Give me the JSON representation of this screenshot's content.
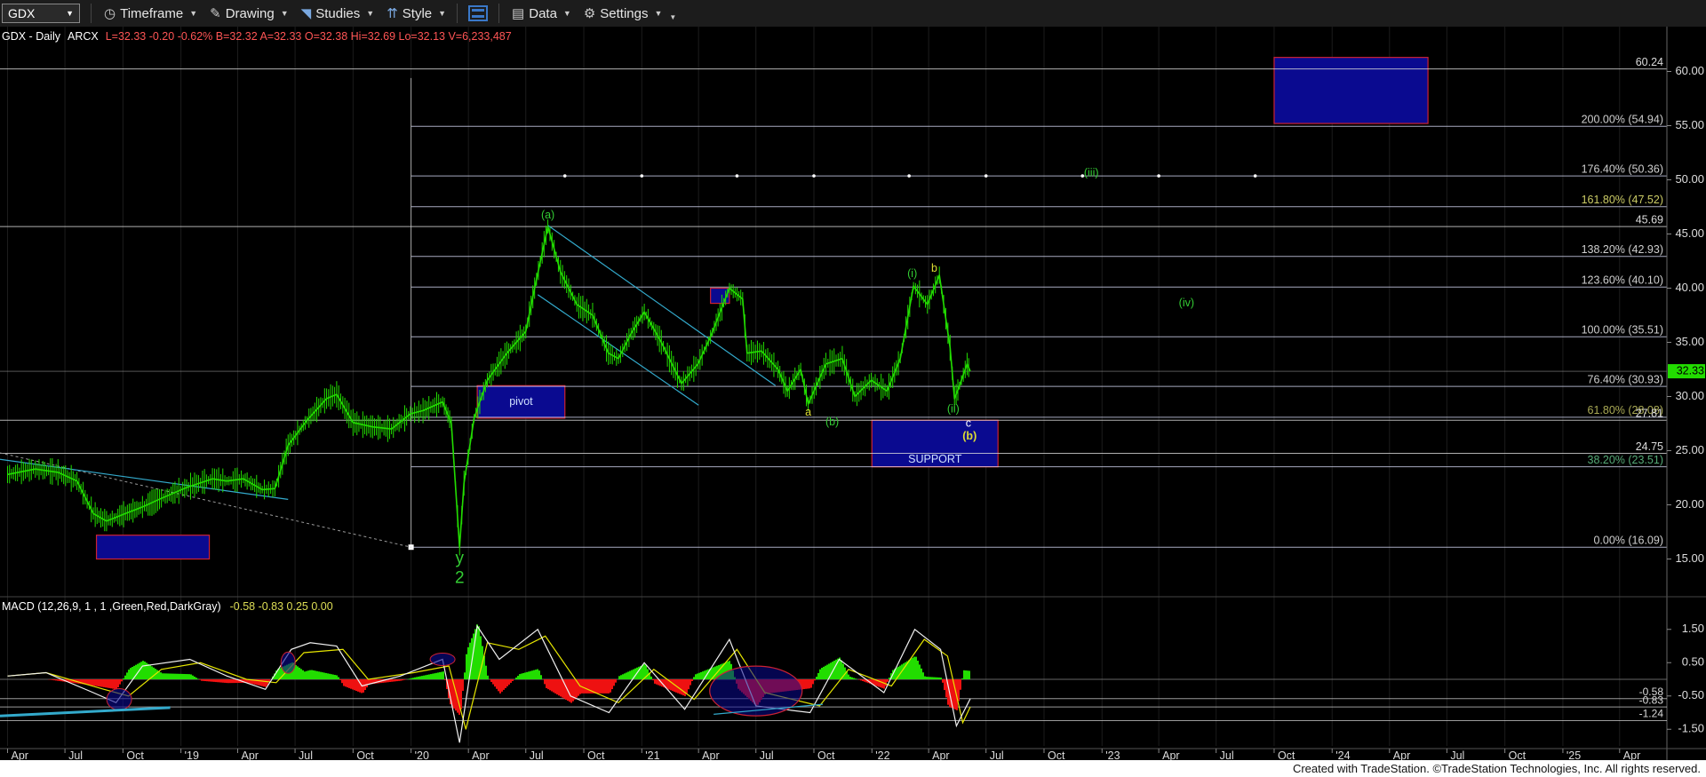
{
  "toolbar": {
    "symbol": "GDX",
    "timeframe": "Timeframe",
    "drawing": "Drawing",
    "studies": "Studies",
    "style": "Style",
    "data": "Data",
    "settings": "Settings"
  },
  "header": {
    "title": "GDX - Daily",
    "exchange": "ARCX",
    "quote": "L=32.33  -0.20  -0.62%  B=32.32  A=32.33  O=32.38  Hi=32.69  Lo=32.13  V=6,233,487"
  },
  "macd_header": {
    "label": "MACD (12,26,9, 1 , 1 ,Green,Red,DarkGray)",
    "values": "-0.58   -0.83   0.25   0.00"
  },
  "footer": "Created with TradeStation. ©TradeStation Technologies, Inc. All rights reserved.",
  "colors": {
    "price": "#22dd00",
    "fib_lines": "#dfe3ff",
    "support_box": "#0a0a90",
    "box_border": "#cc2233",
    "trend_channel": "#33aacc",
    "wave_label": "#33cc33",
    "wave_label_yellow": "#dddd33"
  },
  "chart_data": {
    "type": "line",
    "title": "GDX - Daily",
    "price_axis": {
      "min": 12.5,
      "max": 62.5,
      "ticks": [
        15,
        20,
        25,
        30,
        35,
        40,
        45,
        50,
        55,
        60
      ]
    },
    "macd_axis": {
      "min": -2.0,
      "max": 2.0,
      "ticks": [
        -1.5,
        -0.5,
        0.5,
        1.5
      ]
    },
    "x_axis_labels": [
      "Apr",
      "Jul",
      "Oct",
      "'19",
      "Apr",
      "Jul",
      "Oct",
      "'20",
      "Apr",
      "Jul",
      "Oct",
      "'21",
      "Apr",
      "Jul",
      "Oct",
      "'22",
      "Apr",
      "Jul",
      "Oct",
      "'23",
      "Apr",
      "Jul",
      "Oct",
      "'24",
      "Apr",
      "Jul",
      "Oct",
      "'25",
      "Apr"
    ],
    "x_axis_dates": [
      "2018-04",
      "2018-07",
      "2018-10",
      "2019-01",
      "2019-04",
      "2019-07",
      "2019-10",
      "2020-01",
      "2020-04",
      "2020-07",
      "2020-10",
      "2021-01",
      "2021-04",
      "2021-07",
      "2021-10",
      "2022-01",
      "2022-04",
      "2022-07",
      "2022-10",
      "2023-01",
      "2023-04",
      "2023-07",
      "2023-10",
      "2024-01",
      "2024-04",
      "2024-07",
      "2024-10",
      "2025-01",
      "2025-04"
    ],
    "last_price": 32.33,
    "fib_levels": [
      {
        "label": "200.00% (54.94)",
        "value": 54.94
      },
      {
        "label": "176.40% (50.36)",
        "value": 50.36
      },
      {
        "label": "161.80% (47.52)",
        "value": 47.52
      },
      {
        "label": "138.20% (42.93)",
        "value": 42.93
      },
      {
        "label": "123.60% (40.10)",
        "value": 40.1
      },
      {
        "label": "100.00% (35.51)",
        "value": 35.51
      },
      {
        "label": "76.40% (30.93)",
        "value": 30.93
      },
      {
        "label": "61.80% (28.08)",
        "value": 28.08
      },
      {
        "label": "38.20% (23.51)",
        "value": 23.51
      },
      {
        "label": "0.00% (16.09)",
        "value": 16.09
      }
    ],
    "price_levels": [
      {
        "label": "60.24",
        "value": 60.24
      },
      {
        "label": "45.69",
        "value": 45.69
      },
      {
        "label": "27.81",
        "value": 27.81
      },
      {
        "label": "24.75",
        "value": 24.75
      }
    ],
    "boxes": [
      {
        "label": "pivot",
        "date_from": "2020-04-15",
        "date_to": "2020-09-01",
        "top": 31.0,
        "bottom": 28.0
      },
      {
        "label": "SUPPORT",
        "date_from": "2022-01-01",
        "date_to": "2022-07-20",
        "top": 27.81,
        "bottom": 23.51
      },
      {
        "label": "",
        "date_from": "2023-10-01",
        "date_to": "2024-06-01",
        "top": 61.3,
        "bottom": 55.2
      },
      {
        "label": "",
        "date_from": "2018-08-20",
        "date_to": "2019-02-15",
        "top": 17.2,
        "bottom": 15.0
      },
      {
        "label": "",
        "date_from": "2021-04-20",
        "date_to": "2021-05-20",
        "top": 40.0,
        "bottom": 38.6
      }
    ],
    "wave_labels": [
      {
        "text": "(a)",
        "date": "2020-08-05",
        "price": 46.7,
        "color": "green"
      },
      {
        "text": "a",
        "date": "2021-09-22",
        "price": 28.5,
        "color": "yellow"
      },
      {
        "text": "(b)",
        "date": "2021-10-30",
        "price": 27.6,
        "color": "green"
      },
      {
        "text": "(i)",
        "date": "2022-03-06",
        "price": 41.3,
        "color": "green"
      },
      {
        "text": "b",
        "date": "2022-04-10",
        "price": 41.8,
        "color": "yellow"
      },
      {
        "text": "(ii)",
        "date": "2022-05-10",
        "price": 28.8,
        "color": "green"
      },
      {
        "text": "c",
        "date": "2022-06-03",
        "price": 27.5,
        "color": "white"
      },
      {
        "text": "(b)",
        "date": "2022-06-05",
        "price": 26.3,
        "color": "yellow"
      },
      {
        "text": "(iii)",
        "date": "2022-12-15",
        "price": 50.6,
        "color": "green"
      },
      {
        "text": "(iv)",
        "date": "2023-05-15",
        "price": 38.6,
        "color": "green"
      },
      {
        "text": "y",
        "date": "2020-03-18",
        "price": 15.0,
        "color": "green"
      },
      {
        "text": "2",
        "date": "2020-03-18",
        "price": 13.2,
        "color": "green"
      }
    ],
    "series": [
      {
        "name": "GDX",
        "points": [
          [
            "2018-04-01",
            22.8
          ],
          [
            "2018-05-15",
            23.3
          ],
          [
            "2018-06-20",
            23.0
          ],
          [
            "2018-07-20",
            22.2
          ],
          [
            "2018-08-15",
            19.2
          ],
          [
            "2018-09-05",
            18.5
          ],
          [
            "2018-10-05",
            19.2
          ],
          [
            "2018-11-01",
            19.8
          ],
          [
            "2018-12-01",
            20.6
          ],
          [
            "2019-01-10",
            21.6
          ],
          [
            "2019-02-20",
            22.4
          ],
          [
            "2019-03-15",
            22.2
          ],
          [
            "2019-04-10",
            22.4
          ],
          [
            "2019-05-10",
            21.4
          ],
          [
            "2019-05-30",
            21.5
          ],
          [
            "2019-06-20",
            25.5
          ],
          [
            "2019-07-20",
            27.8
          ],
          [
            "2019-08-20",
            29.8
          ],
          [
            "2019-09-05",
            30.2
          ],
          [
            "2019-10-01",
            27.6
          ],
          [
            "2019-11-01",
            27.2
          ],
          [
            "2019-12-01",
            27.0
          ],
          [
            "2019-12-31",
            28.4
          ],
          [
            "2020-01-20",
            28.7
          ],
          [
            "2020-02-20",
            29.5
          ],
          [
            "2020-03-05",
            27.5
          ],
          [
            "2020-03-18",
            16.09
          ],
          [
            "2020-03-25",
            22.0
          ],
          [
            "2020-04-10",
            28.0
          ],
          [
            "2020-05-01",
            31.5
          ],
          [
            "2020-06-01",
            34.0
          ],
          [
            "2020-07-01",
            36.0
          ],
          [
            "2020-07-15",
            40.0
          ],
          [
            "2020-08-05",
            45.69
          ],
          [
            "2020-08-25",
            41.5
          ],
          [
            "2020-09-20",
            38.5
          ],
          [
            "2020-10-15",
            37.5
          ],
          [
            "2020-11-09",
            34.0
          ],
          [
            "2020-11-25",
            33.5
          ],
          [
            "2020-12-15",
            35.8
          ],
          [
            "2021-01-05",
            37.8
          ],
          [
            "2021-02-01",
            35.0
          ],
          [
            "2021-03-05",
            31.2
          ],
          [
            "2021-03-31",
            33.0
          ],
          [
            "2021-04-20",
            35.5
          ],
          [
            "2021-05-20",
            40.0
          ],
          [
            "2021-06-10",
            39.0
          ],
          [
            "2021-06-17",
            34.0
          ],
          [
            "2021-07-10",
            34.2
          ],
          [
            "2021-08-05",
            32.5
          ],
          [
            "2021-08-20",
            30.5
          ],
          [
            "2021-09-10",
            32.5
          ],
          [
            "2021-09-22",
            29.3
          ],
          [
            "2021-10-20",
            33.0
          ],
          [
            "2021-11-15",
            33.5
          ],
          [
            "2021-12-05",
            30.0
          ],
          [
            "2021-12-31",
            31.5
          ],
          [
            "2022-01-25",
            30.5
          ],
          [
            "2022-02-15",
            33.5
          ],
          [
            "2022-03-08",
            40.2
          ],
          [
            "2022-03-30",
            38.5
          ],
          [
            "2022-04-18",
            41.2
          ],
          [
            "2022-05-05",
            34.5
          ],
          [
            "2022-05-12",
            29.8
          ],
          [
            "2022-05-20",
            31.0
          ],
          [
            "2022-06-01",
            33.0
          ],
          [
            "2022-06-06",
            32.33
          ]
        ]
      }
    ],
    "macd": {
      "zero_line": 0,
      "reference_lines": [
        -0.58,
        -0.83,
        -1.24
      ],
      "macd_line": [
        [
          "2018-04-01",
          0.1
        ],
        [
          "2018-06-01",
          0.2
        ],
        [
          "2018-08-15",
          -0.4
        ],
        [
          "2018-09-20",
          -0.7
        ],
        [
          "2018-11-01",
          0.4
        ],
        [
          "2019-01-15",
          0.6
        ],
        [
          "2019-03-15",
          0.1
        ],
        [
          "2019-05-15",
          -0.3
        ],
        [
          "2019-06-25",
          0.9
        ],
        [
          "2019-07-25",
          1.1
        ],
        [
          "2019-09-05",
          1.0
        ],
        [
          "2019-10-15",
          -0.2
        ],
        [
          "2019-12-15",
          0.1
        ],
        [
          "2020-02-20",
          0.6
        ],
        [
          "2020-03-18",
          -1.9
        ],
        [
          "2020-04-15",
          1.6
        ],
        [
          "2020-05-20",
          0.6
        ],
        [
          "2020-07-20",
          1.5
        ],
        [
          "2020-09-10",
          -0.5
        ],
        [
          "2020-11-10",
          -1.0
        ],
        [
          "2021-01-05",
          0.5
        ],
        [
          "2021-03-10",
          -0.9
        ],
        [
          "2021-05-20",
          1.2
        ],
        [
          "2021-07-01",
          -0.8
        ],
        [
          "2021-09-25",
          -1.0
        ],
        [
          "2021-11-10",
          0.6
        ],
        [
          "2022-01-20",
          -0.4
        ],
        [
          "2022-03-10",
          1.5
        ],
        [
          "2022-04-20",
          0.9
        ],
        [
          "2022-05-15",
          -1.4
        ],
        [
          "2022-06-06",
          -0.58
        ]
      ],
      "signal_line": [
        [
          "2018-04-01",
          0.1
        ],
        [
          "2018-06-01",
          0.2
        ],
        [
          "2018-09-01",
          -0.3
        ],
        [
          "2018-10-10",
          -0.5
        ],
        [
          "2018-12-01",
          0.3
        ],
        [
          "2019-02-01",
          0.5
        ],
        [
          "2019-04-15",
          0.0
        ],
        [
          "2019-06-01",
          -0.1
        ],
        [
          "2019-07-15",
          0.8
        ],
        [
          "2019-09-15",
          0.9
        ],
        [
          "2019-10-25",
          0.0
        ],
        [
          "2020-01-05",
          0.2
        ],
        [
          "2020-03-01",
          0.4
        ],
        [
          "2020-03-28",
          -1.5
        ],
        [
          "2020-05-01",
          1.1
        ],
        [
          "2020-06-20",
          0.9
        ],
        [
          "2020-08-01",
          1.3
        ],
        [
          "2020-09-25",
          -0.2
        ],
        [
          "2020-11-25",
          -0.7
        ],
        [
          "2021-01-20",
          0.3
        ],
        [
          "2021-03-25",
          -0.6
        ],
        [
          "2021-06-01",
          0.9
        ],
        [
          "2021-07-15",
          -0.4
        ],
        [
          "2021-10-10",
          -0.8
        ],
        [
          "2021-11-25",
          0.3
        ],
        [
          "2022-02-01",
          -0.2
        ],
        [
          "2022-03-25",
          1.2
        ],
        [
          "2022-05-01",
          0.7
        ],
        [
          "2022-05-25",
          -1.3
        ],
        [
          "2022-06-06",
          -0.83
        ]
      ]
    }
  }
}
